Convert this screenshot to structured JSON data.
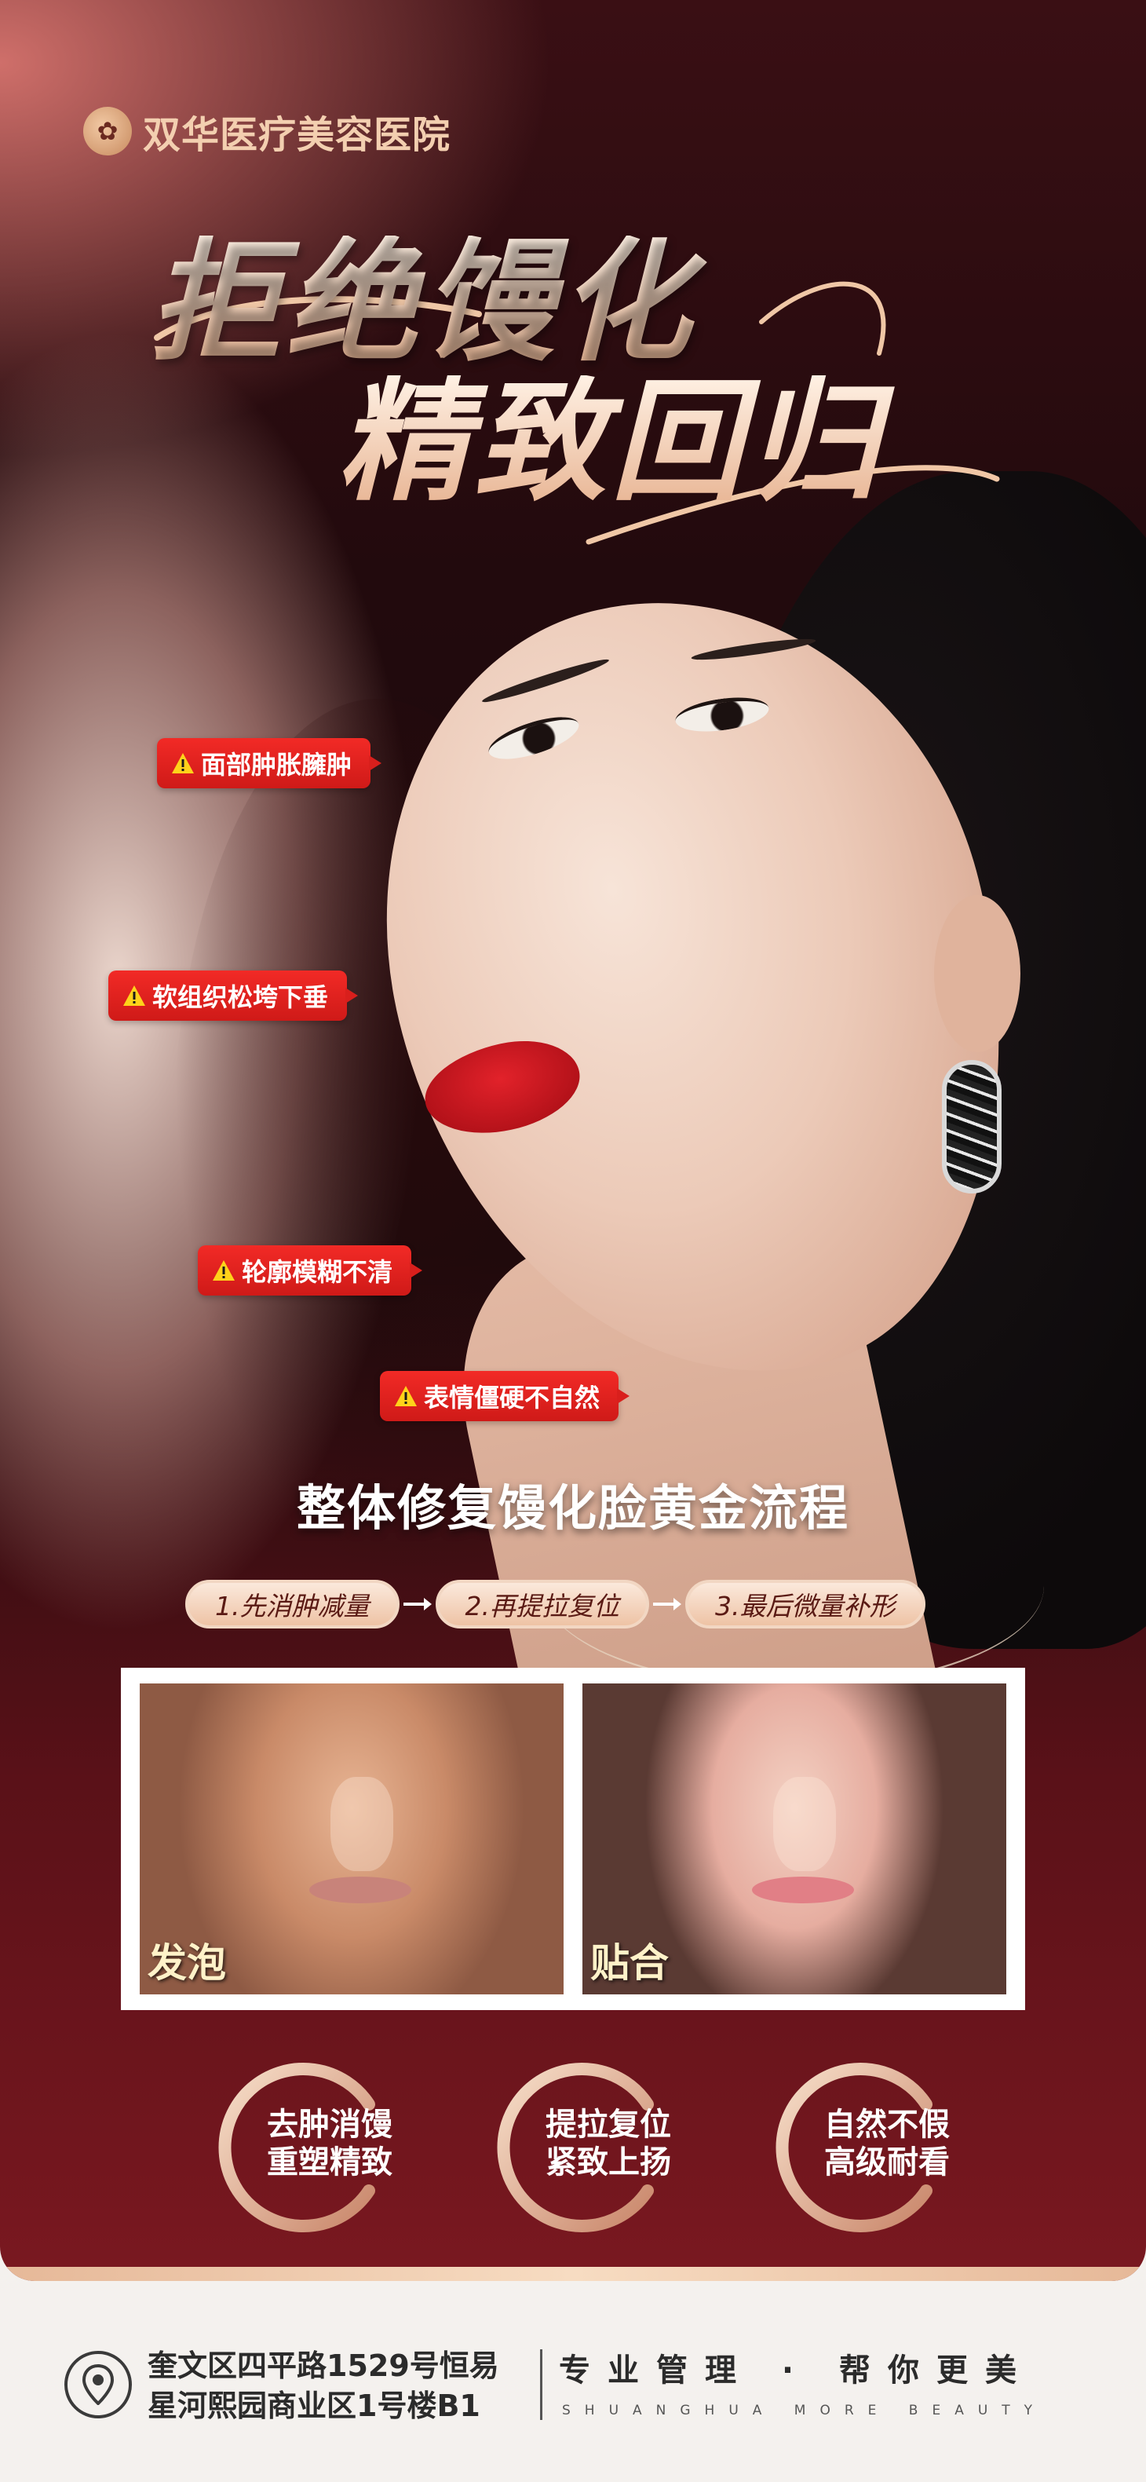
{
  "brand": {
    "name": "双华医疗美容医院"
  },
  "headline": {
    "line1": "拒绝馒化",
    "line2": "精致回归"
  },
  "warnings": [
    {
      "label": "面部肿胀臃肿"
    },
    {
      "label": "软组织松垮下垂"
    },
    {
      "label": "轮廓模糊不清"
    },
    {
      "label": "表情僵硬不自然"
    }
  ],
  "process": {
    "title": "整体修复馒化脸黄金流程",
    "steps": [
      "1.先消肿减量",
      "2.再提拉复位",
      "3.最后微量补形"
    ]
  },
  "comparison": {
    "before_label": "发泡",
    "after_label": "贴合"
  },
  "benefits": [
    {
      "line1": "去肿消馒",
      "line2": "重塑精致"
    },
    {
      "line1": "提拉复位",
      "line2": "紧致上扬"
    },
    {
      "line1": "自然不假",
      "line2": "高级耐看"
    }
  ],
  "footer": {
    "address_line1": "奎文区四平路1529号恒易",
    "address_line2": "星河熙园商业区1号楼B1",
    "slogan": "专业管理 · 帮你更美",
    "slogan_en": "SHUANGHUA MORE BEAUTY"
  },
  "colors": {
    "accent_red": "#e3221f",
    "gold": "#e8b594",
    "dark": "#1b0a0c"
  }
}
